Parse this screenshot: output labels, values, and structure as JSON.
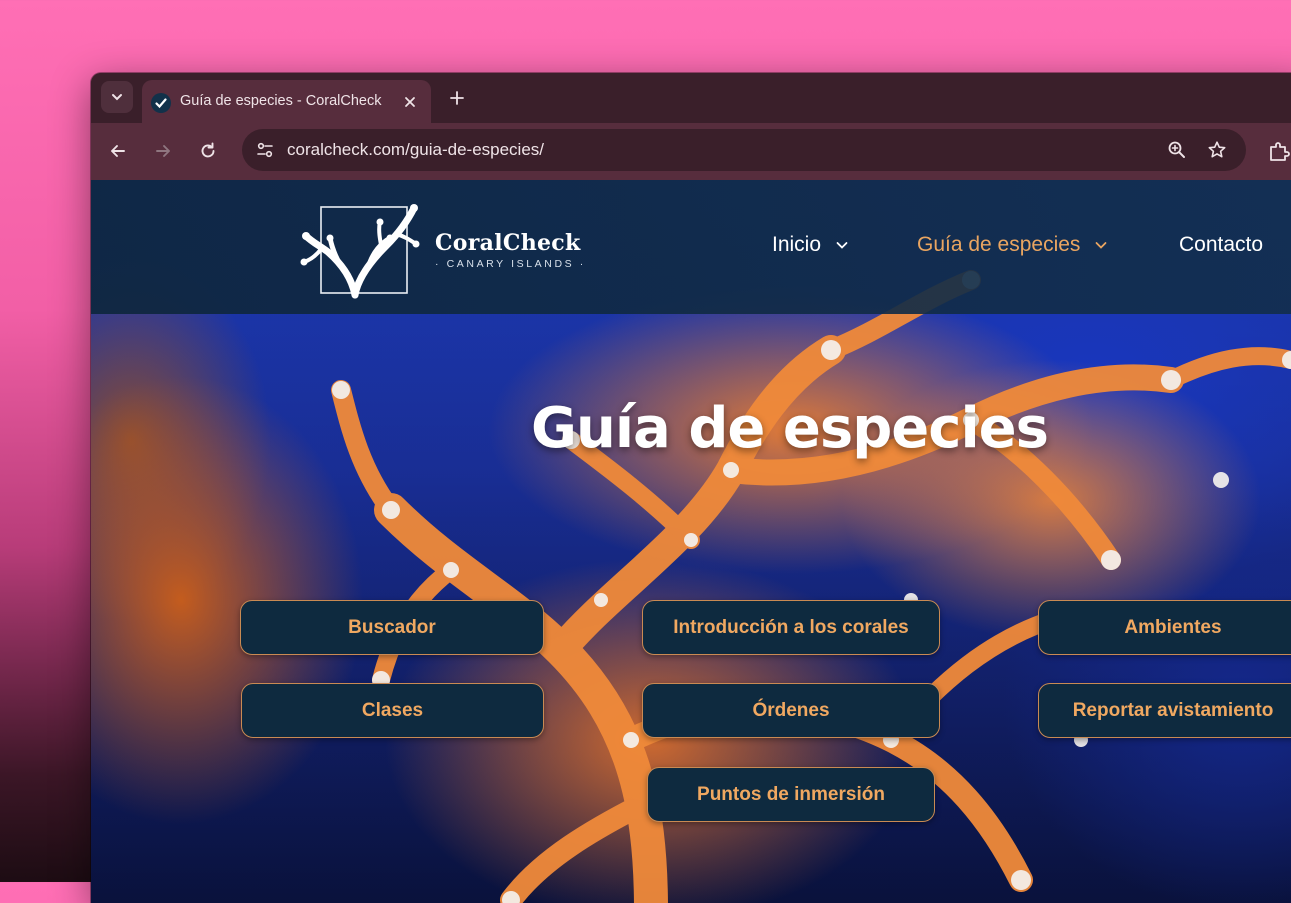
{
  "browser": {
    "tab_title": "Guía de especies - CoralCheck",
    "url": "coralcheck.com/guia-de-especies/"
  },
  "site": {
    "logo_title": "CoralCheck",
    "logo_subtitle": "· CANARY ISLANDS ·",
    "nav": [
      {
        "label": "Inicio",
        "active": false
      },
      {
        "label": "Guía de especies",
        "active": true
      },
      {
        "label": "Contacto",
        "active": false
      }
    ]
  },
  "hero": {
    "title": "Guía de especies",
    "buttons": [
      "Buscador",
      "Introducción a los corales",
      "Ambientes",
      "Clases",
      "Órdenes",
      "Reportar avistamiento",
      "Puntos de inmersión"
    ]
  },
  "colors": {
    "accent": "#f0a861",
    "button_bg": "#0e2a3f",
    "header_bg": "#0e263e",
    "desktop": "#ff6fb5"
  }
}
